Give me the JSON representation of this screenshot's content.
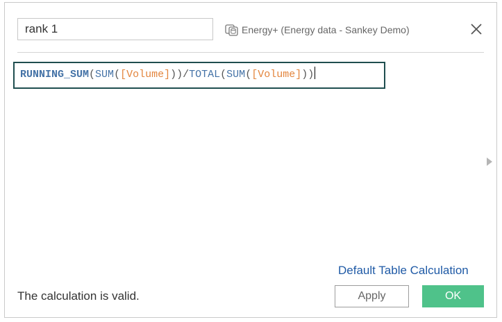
{
  "dialog": {
    "calc_name": "rank 1",
    "datasource": "Energy+ (Energy data - Sankey Demo)",
    "datasource_icon": "datasource-icon",
    "close_icon": "close-icon"
  },
  "formula": {
    "tokens": [
      "RUNNING_SUM",
      "(",
      "SUM",
      "(",
      "[Volume]",
      ")",
      ")",
      "/",
      "TOTAL",
      "(",
      "SUM",
      "(",
      "[Volume]",
      ")",
      ")"
    ]
  },
  "footer": {
    "default_link": "Default Table Calculation",
    "status": "The calculation is valid.",
    "apply_label": "Apply",
    "ok_label": "OK"
  },
  "colors": {
    "function": "#4573a7",
    "field": "#e3853d",
    "editor_border": "#1f4e4f",
    "ok_button": "#4fc28a",
    "link": "#1f5aa6"
  }
}
